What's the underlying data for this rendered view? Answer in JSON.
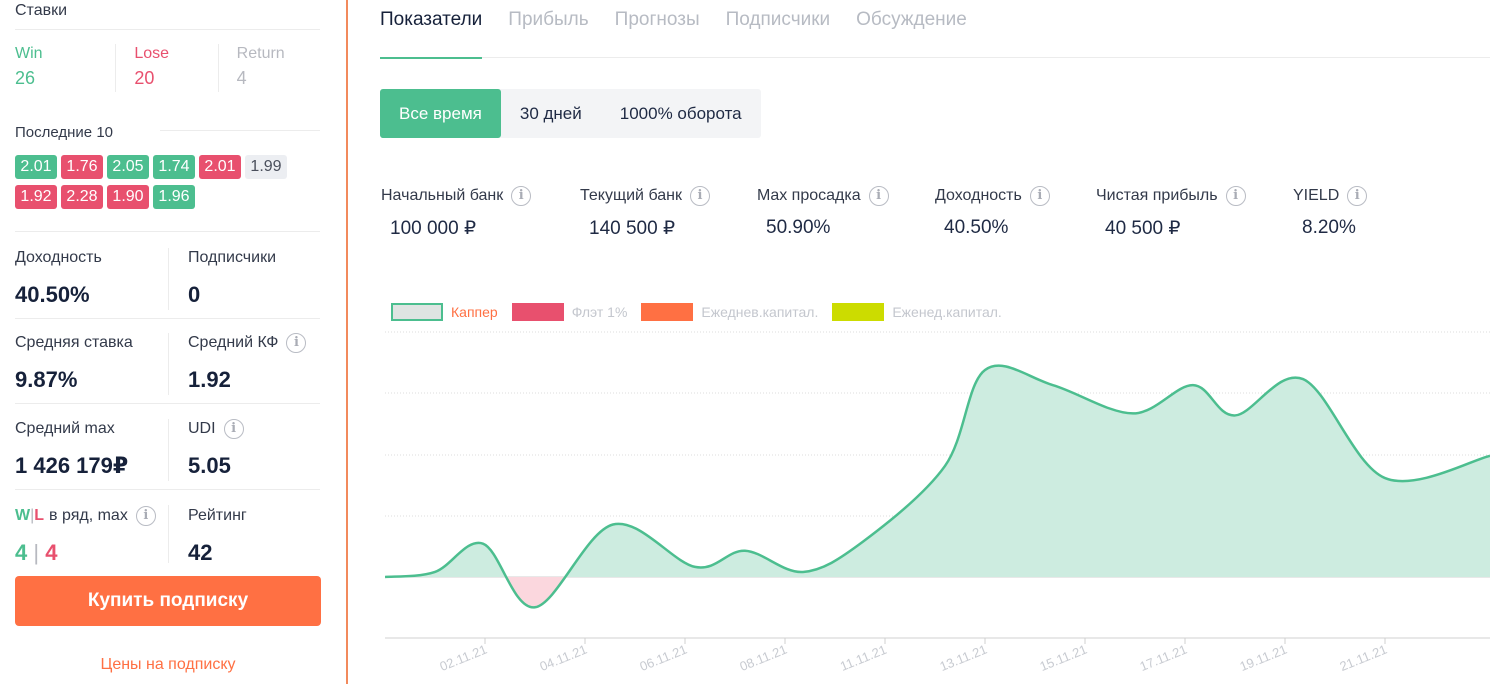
{
  "sidebar": {
    "bets_title": "Ставки",
    "win_label": "Win",
    "win_value": "26",
    "lose_label": "Lose",
    "lose_value": "20",
    "return_label": "Return",
    "return_value": "4",
    "last10_title": "Последние 10",
    "last10_row1": [
      {
        "v": "2.01",
        "r": "win"
      },
      {
        "v": "1.76",
        "r": "lose"
      },
      {
        "v": "2.05",
        "r": "win"
      },
      {
        "v": "1.74",
        "r": "win"
      },
      {
        "v": "2.01",
        "r": "lose"
      },
      {
        "v": "1.99",
        "r": "ret"
      }
    ],
    "last10_row2": [
      {
        "v": "1.92",
        "r": "lose"
      },
      {
        "v": "2.28",
        "r": "lose"
      },
      {
        "v": "1.90",
        "r": "lose"
      },
      {
        "v": "1.96",
        "r": "win"
      }
    ],
    "yield_label": "Доходность",
    "yield_value": "40.50%",
    "subscribers_label": "Подписчики",
    "subscribers_value": "0",
    "avg_stake_label": "Средняя ставка",
    "avg_stake_value": "9.87%",
    "avg_kf_label": "Средний КФ",
    "avg_kf_value": "1.92",
    "avg_max_label": "Средний max",
    "avg_max_value": "1 426 179₽",
    "udi_label": "UDI",
    "udi_value": "5.05",
    "wl_w": "W",
    "wl_sep": "|",
    "wl_l": "L",
    "wl_label_rest": "в ряд, max",
    "wl_win_value": "4",
    "wl_value_sep": "|",
    "wl_lose_value": "4",
    "rating_label": "Рейтинг",
    "rating_value": "42",
    "buy_button": "Купить подписку",
    "prices_link": "Цены на подписку"
  },
  "tabs": [
    "Показатели",
    "Прибыль",
    "Прогнозы",
    "Подписчики",
    "Обсуждение"
  ],
  "active_tab": 0,
  "period_buttons": [
    "Все время",
    "30 дней",
    "1000% оборота"
  ],
  "active_period": 0,
  "metrics": [
    {
      "label": "Начальный банк",
      "value": "100 000 ₽"
    },
    {
      "label": "Текущий банк",
      "value": "140 500 ₽"
    },
    {
      "label": "Max просадка",
      "value": "50.90%"
    },
    {
      "label": "Доходность",
      "value": "40.50%"
    },
    {
      "label": "Чистая прибыль",
      "value": "40 500 ₽"
    },
    {
      "label": "YIELD",
      "value": "8.20%"
    }
  ],
  "colors": {
    "accent_green": "#4cbe8f",
    "lose_red": "#e8506e",
    "orange": "#ff7043",
    "olive": "#ccdc00",
    "area_fill": "#cdece0",
    "negative_fill": "#fbd7de"
  },
  "icons": [
    "info-icon"
  ],
  "chart_data": {
    "type": "area",
    "legend": [
      {
        "name": "Каппер",
        "active": true
      },
      {
        "name": "Флэт 1%",
        "active": false
      },
      {
        "name": "Ежеднев.капитал.",
        "active": false
      },
      {
        "name": "Еженед.капитал.",
        "active": false
      }
    ],
    "x_ticks": [
      "02.11.21",
      "04.11.21",
      "06.11.21",
      "08.11.21",
      "11.11.21",
      "13.11.21",
      "15.11.21",
      "17.11.21",
      "19.11.21",
      "21.11.21"
    ],
    "x": [
      0,
      1,
      2,
      3,
      4,
      5,
      6,
      7,
      8,
      9,
      10,
      11,
      12,
      13,
      14,
      15,
      16,
      17,
      18,
      19,
      20,
      21
    ],
    "y": [
      0,
      5,
      33,
      -30,
      52,
      10,
      26,
      5,
      35,
      110,
      205,
      190,
      162,
      190,
      160,
      196,
      98,
      120
    ],
    "y_px_hint_none": true,
    "grid": true
  }
}
